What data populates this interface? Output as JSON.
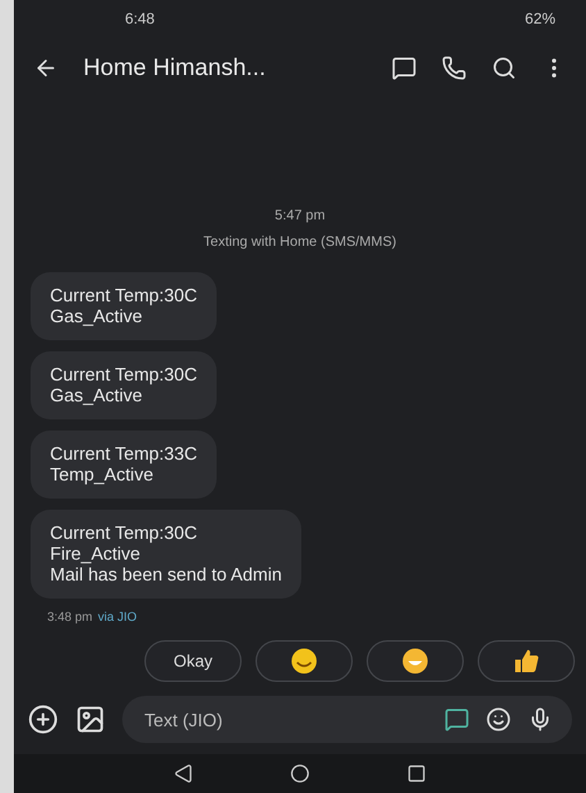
{
  "status_bar": {
    "time": "6:48",
    "battery": "62%"
  },
  "app_bar": {
    "title": "Home Himansh..."
  },
  "conversation": {
    "timestamp": "5:47 pm",
    "info": "Texting with Home (SMS/MMS)",
    "messages": [
      {
        "lines": [
          "Current Temp:30C",
          "Gas_Active"
        ]
      },
      {
        "lines": [
          "Current Temp:30C",
          "Gas_Active"
        ]
      },
      {
        "lines": [
          "Current Temp:33C",
          "Temp_Active"
        ]
      },
      {
        "lines": [
          "Current Temp:30C",
          "Fire_Active",
          "Mail has been send to Admin"
        ]
      }
    ],
    "sent_time": "3:48 pm",
    "sent_via": "via JIO"
  },
  "suggestions": [
    {
      "kind": "text",
      "label": "Okay"
    },
    {
      "kind": "smile"
    },
    {
      "kind": "grin"
    },
    {
      "kind": "thumb"
    }
  ],
  "composer": {
    "placeholder": "Text (JIO)"
  }
}
